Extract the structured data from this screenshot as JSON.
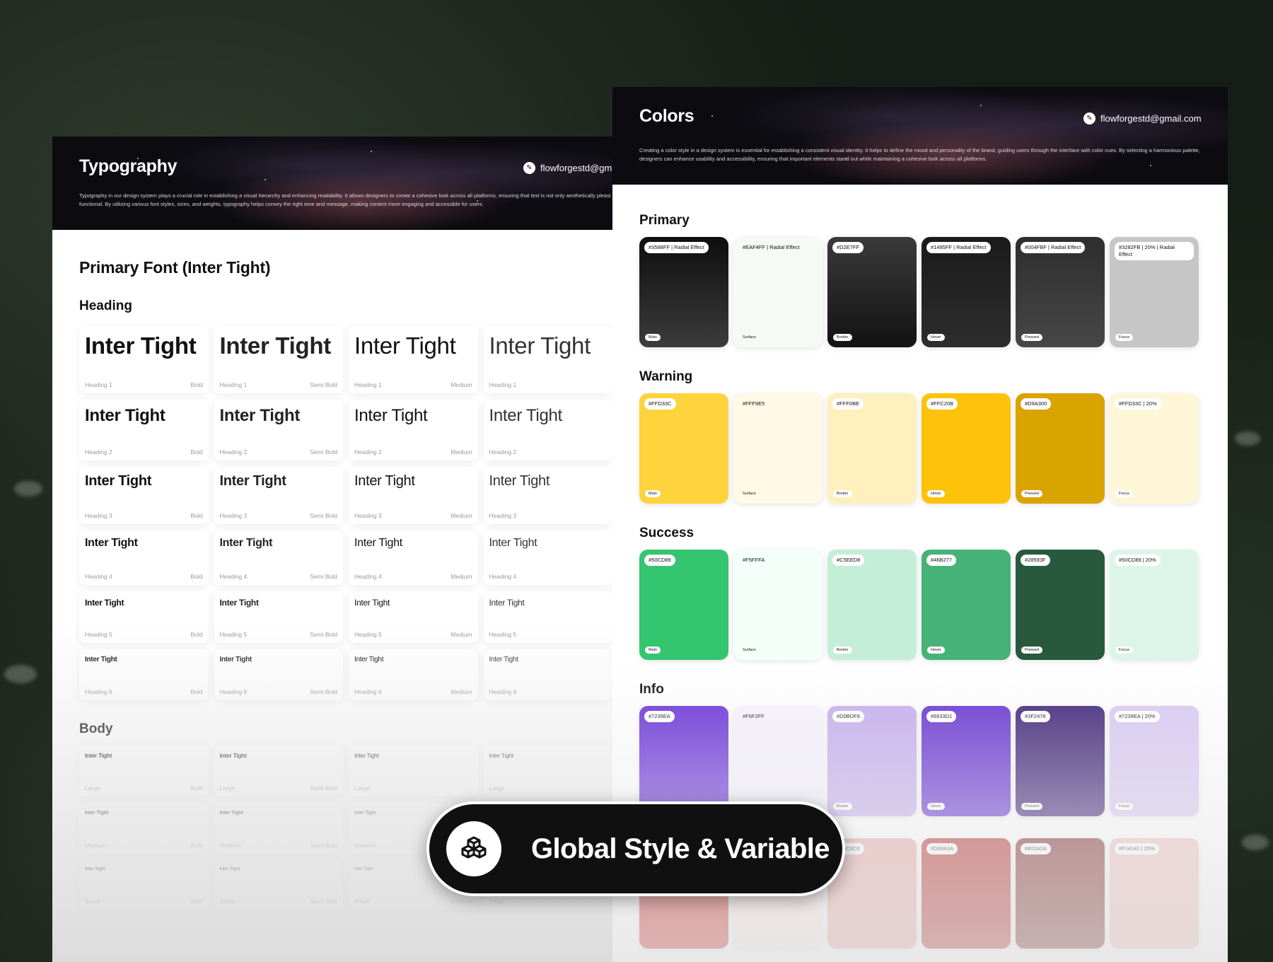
{
  "typography": {
    "title": "Typography",
    "email": "flowforgestd@gm",
    "description": "Typography in our design system plays a crucial role in establishing a visual hierarchy and enhancing readability. It allows designers to create a cohesive look across all platforms, ensuring that text is not only aesthetically pleasi functional. By utilizing various font styles, sizes, and weights, typography helps convey the right tone and message, making content more engaging and accessible for users.",
    "primary_font": "Primary Font (Inter Tight)",
    "heading_title": "Heading",
    "body_title": "Body",
    "sample": "Inter Tight",
    "headings": [
      {
        "level": "Heading 1",
        "weights": [
          "Bold",
          "Semi Bold",
          "Medium",
          ""
        ]
      },
      {
        "level": "Heading 2",
        "weights": [
          "Bold",
          "Semi Bold",
          "Medium",
          ""
        ]
      },
      {
        "level": "Heading 3",
        "weights": [
          "Bold",
          "Semi Bold",
          "Medium",
          ""
        ]
      },
      {
        "level": "Heading 4",
        "weights": [
          "Bold",
          "Semi Bold",
          "Medium",
          ""
        ]
      },
      {
        "level": "Heading 5",
        "weights": [
          "Bold",
          "Semi Bold",
          "Medium",
          ""
        ]
      },
      {
        "level": "Heading 6",
        "weights": [
          "Bold",
          "Semi Bold",
          "Medium",
          ""
        ]
      }
    ],
    "body": [
      {
        "level": "Large",
        "weights": [
          "Bold",
          "Semi Bold",
          "",
          ""
        ]
      },
      {
        "level": "Medium",
        "weights": [
          "Bold",
          "Semi Bold",
          "",
          ""
        ]
      },
      {
        "level": "Small",
        "weights": [
          "Bold",
          "Semi Bold",
          "Medium",
          ""
        ]
      }
    ]
  },
  "colors": {
    "title": "Colors",
    "email": "flowforgestd@gmail.com",
    "description": "Creating a color style in a design system is essential for establishing a consistent visual identity. It helps to define the mood and personality of the brand, guiding users through the interface with color cues. By selecting a harmonious palette, designers can enhance usability and accessibility, ensuring that important elements stand out while maintaining a cohesive look across all platforms.",
    "groups": [
      {
        "name": "Primary",
        "swatches": [
          {
            "label": "#3588FF | Radial Effect",
            "role": "Main",
            "bg": "linear-gradient(to bottom,#0e0e0e,#3c3c3c)",
            "light": false
          },
          {
            "label": "#EAF4FF | Radial Effect",
            "role": "Surface",
            "bg": "#f6faf5",
            "light": true
          },
          {
            "label": "#D2E7FF",
            "role": "Border",
            "bg": "linear-gradient(to bottom,#3a3a3a,#121212)",
            "light": false
          },
          {
            "label": "#1495FF | Radial Effect",
            "role": "Hover",
            "bg": "linear-gradient(to bottom,#1b1b1b,#2d2d2d)",
            "light": false
          },
          {
            "label": "#004FBF | Radial Effect",
            "role": "Pressed",
            "bg": "linear-gradient(to bottom,#2e2e2e,#474747)",
            "light": false
          },
          {
            "label": "#3282FB | 20% | Radial Effect",
            "role": "Focus",
            "bg": "#c6c6c6",
            "light": false
          }
        ]
      },
      {
        "name": "Warning",
        "swatches": [
          {
            "label": "#FFD33C",
            "role": "Main",
            "bg": "#ffd33c",
            "light": false
          },
          {
            "label": "#FFF9E5",
            "role": "Surface",
            "bg": "#fff9e5",
            "light": true
          },
          {
            "label": "#FFF0BE",
            "role": "Border",
            "bg": "#fff0be",
            "light": false
          },
          {
            "label": "#FFC20B",
            "role": "Hover",
            "bg": "#ffc20b",
            "light": false
          },
          {
            "label": "#D9A300",
            "role": "Pressed",
            "bg": "#d9a300",
            "light": false
          },
          {
            "label": "#FFD33C | 20%",
            "role": "Focus",
            "bg": "#fff6d8",
            "light": false
          }
        ]
      },
      {
        "name": "Success",
        "swatches": [
          {
            "label": "#50CD89",
            "role": "Main",
            "bg": "#34c570",
            "light": false
          },
          {
            "label": "#F5FFFA",
            "role": "Surface",
            "bg": "#f5fffa",
            "light": true
          },
          {
            "label": "#C5EED8",
            "role": "Border",
            "bg": "#c5eed8",
            "light": false
          },
          {
            "label": "#46B277",
            "role": "Hover",
            "bg": "#46b277",
            "light": false
          },
          {
            "label": "#28593F",
            "role": "Pressed",
            "bg": "#28593f",
            "light": false
          },
          {
            "label": "#50CD89 | 20%",
            "role": "Focus",
            "bg": "#dcf5e8",
            "light": false
          }
        ]
      },
      {
        "name": "Info",
        "swatches": [
          {
            "label": "#7239EA",
            "role": "",
            "bg": "#6a32d8",
            "light": false
          },
          {
            "label": "#F6F2FF",
            "role": "",
            "bg": "#f6f2ff",
            "light": true
          },
          {
            "label": "#D0BDF8",
            "role": "Border",
            "bg": "#c5aeee",
            "light": false
          },
          {
            "label": "#6633D1",
            "role": "Hover",
            "bg": "#6633d1",
            "light": false
          },
          {
            "label": "#3F2478",
            "role": "Pressed",
            "bg": "#3f2478",
            "light": false
          },
          {
            "label": "#7239EA | 20%",
            "role": "Focus",
            "bg": "#d8c9f3",
            "light": false
          }
        ]
      },
      {
        "name": "",
        "swatches": [
          {
            "label": "",
            "role": "",
            "bg": "#c9302c",
            "light": false
          },
          {
            "label": "",
            "role": "",
            "bg": "#fdeceb",
            "light": true
          },
          {
            "label": "#FAC0C0",
            "role": "",
            "bg": "#e8aaa8",
            "light": false
          },
          {
            "label": "#D93A3A",
            "role": "",
            "bg": "#b52d2b",
            "light": false
          },
          {
            "label": "#802A2A",
            "role": "",
            "bg": "#802a2a",
            "light": false
          },
          {
            "label": "#F14141 | 20%",
            "role": "",
            "bg": "#f0c2c0",
            "light": false
          }
        ]
      }
    ]
  },
  "badge": {
    "label": "Global Style & Variable",
    "icon": "cubes-icon"
  }
}
